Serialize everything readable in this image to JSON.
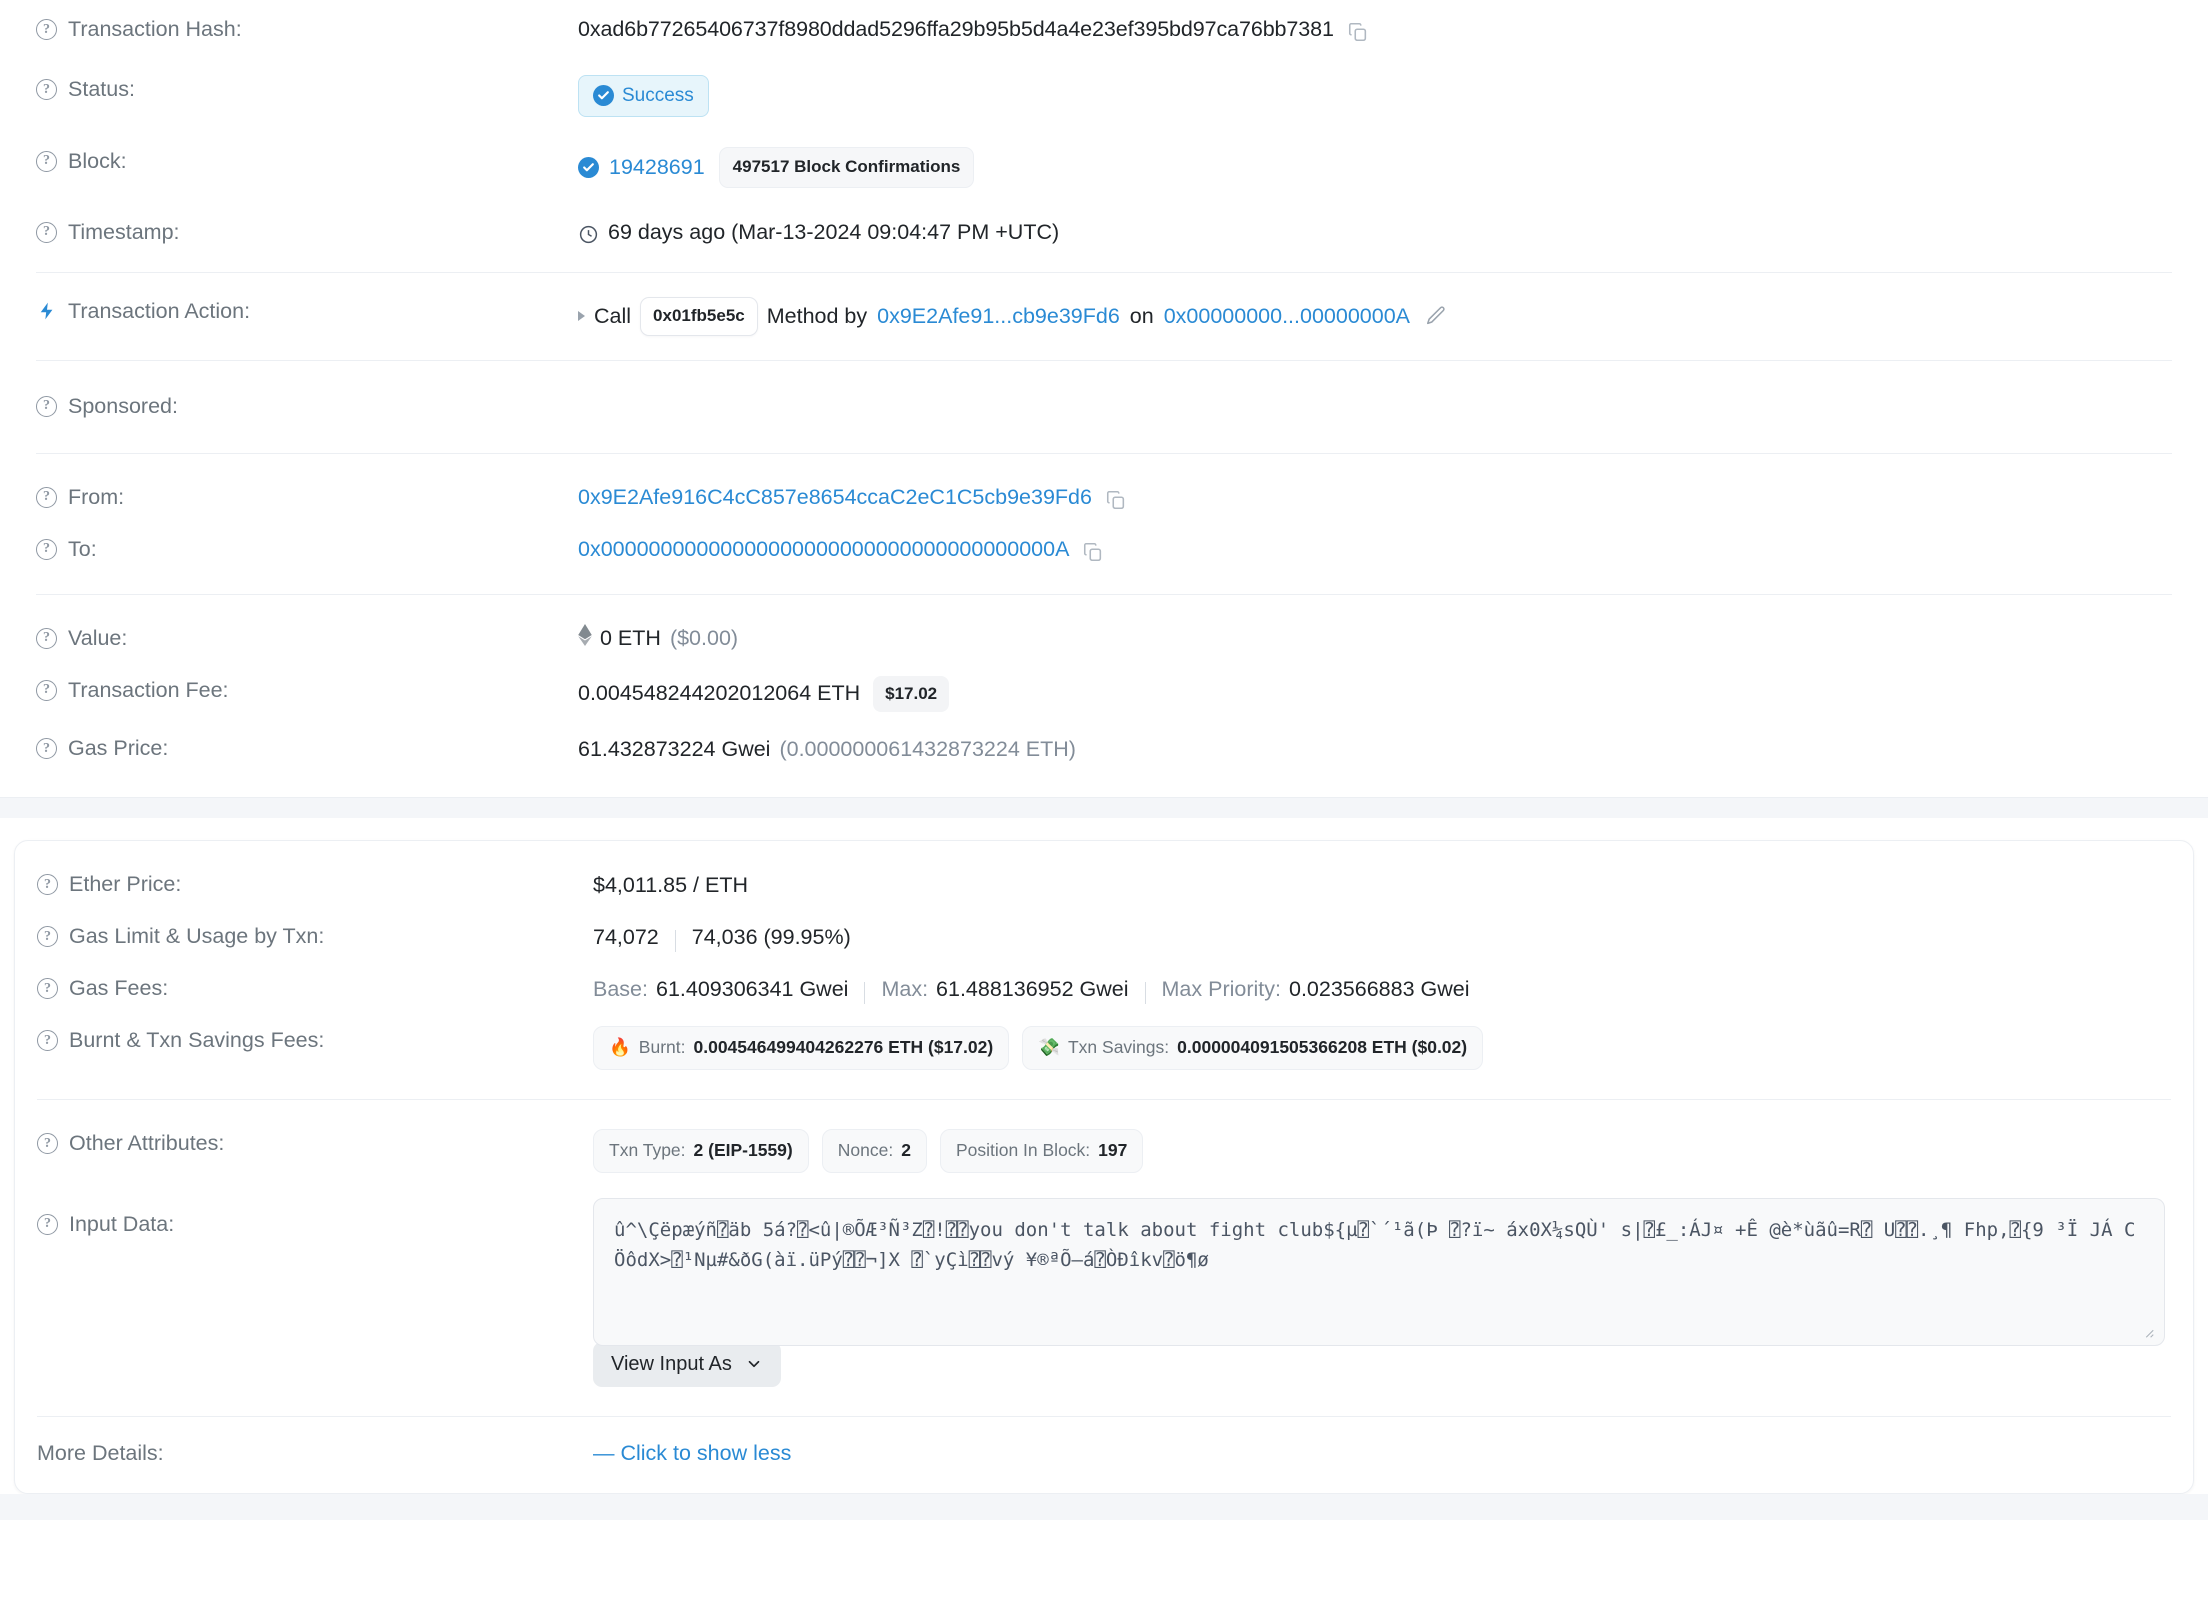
{
  "transaction": {
    "hash": {
      "label": "Transaction Hash:",
      "value": "0xad6b77265406737f8980ddad5296ffa29b95b5d4a4e23ef395bd97ca76bb7381"
    },
    "status": {
      "label": "Status:",
      "value": "Success"
    },
    "block": {
      "label": "Block:",
      "number": "19428691",
      "confirmations": "497517 Block Confirmations"
    },
    "timestamp": {
      "label": "Timestamp:",
      "value": "69 days ago (Mar-13-2024 09:04:47 PM +UTC)"
    },
    "action": {
      "label": "Transaction Action:",
      "call_text": "Call",
      "method_id": "0x01fb5e5c",
      "method_by_text": "Method by",
      "from_short": "0x9E2Afe91...cb9e39Fd6",
      "on_text": "on",
      "contract_short": "0x00000000...00000000A"
    },
    "sponsored": {
      "label": "Sponsored:"
    },
    "from": {
      "label": "From:",
      "value": "0x9E2Afe916C4cC857e8654ccaC2eC1C5cb9e39Fd6"
    },
    "to": {
      "label": "To:",
      "value": "0x00000000000000000000000000000000000000A"
    },
    "value": {
      "label": "Value:",
      "eth": "0 ETH",
      "usd": "($0.00)"
    },
    "fee": {
      "label": "Transaction Fee:",
      "eth": "0.004548244202012064 ETH",
      "usd": "$17.02"
    },
    "gas_price": {
      "label": "Gas Price:",
      "gwei": "61.432873224 Gwei",
      "eth": "(0.000000061432873224 ETH)"
    }
  },
  "details": {
    "ether_price": {
      "label": "Ether Price:",
      "value": "$4,011.85 / ETH"
    },
    "gas_limit": {
      "label": "Gas Limit & Usage by Txn:",
      "limit": "74,072",
      "usage": "74,036 (99.95%)"
    },
    "gas_fees": {
      "label": "Gas Fees:",
      "base_label": "Base:",
      "base_value": "61.409306341 Gwei",
      "max_label": "Max:",
      "max_value": "61.488136952 Gwei",
      "max_priority_label": "Max Priority:",
      "max_priority_value": "0.023566883 Gwei"
    },
    "burnt_savings": {
      "label": "Burnt & Txn Savings Fees:",
      "burnt_label": "Burnt:",
      "burnt_value": "0.004546499404262276 ETH ($17.02)",
      "savings_label": "Txn Savings:",
      "savings_value": "0.000004091505366208 ETH ($0.02)"
    },
    "other_attributes": {
      "label": "Other Attributes:",
      "items": [
        {
          "key": "Txn Type:",
          "val": "2 (EIP-1559)"
        },
        {
          "key": "Nonce:",
          "val": "2"
        },
        {
          "key": "Position In Block:",
          "val": "197"
        }
      ]
    },
    "input_data": {
      "label": "Input Data:",
      "value": "û^\\Çëpæýñ⍰äb 5á?⍰<û|®ÕÆ³Ñ³Z⍰!⍰⍰you don't talk about fight club${µ⍰`´¹ã(Þ ⍰?ï~ áx0X¼sQÙ' s|⍰£_:ÁJ¤ +Ê @è*ùãû=R⍰ U⍰⍰.¸¶ Fhp,⍰{9 ³Ï JÁ CÖôdX>⍰¹Nµ#&ðG(àï.üPý⍰⍰¬]X ⍰`yÇì⍰⍰vý ¥®ªÕ–á⍰ÒÐîkv⍰ö¶ø",
      "button_label": "View Input As"
    },
    "more_details": {
      "label": "More Details:",
      "link_text": "— Click to show less"
    }
  }
}
